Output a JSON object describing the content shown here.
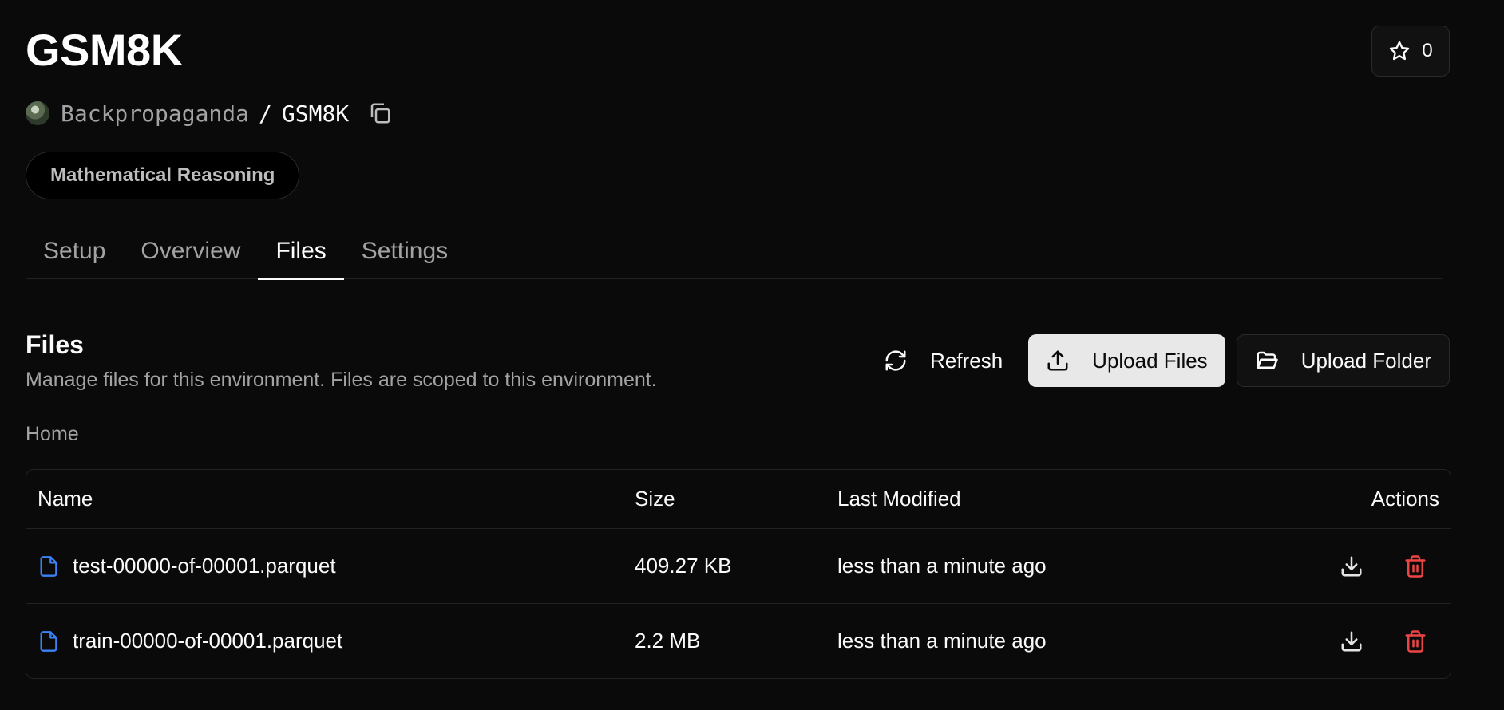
{
  "header": {
    "title": "GSM8K",
    "stars": "0",
    "owner": "Backpropaganda",
    "separator": "/",
    "repo_name": "GSM8K",
    "tag": "Mathematical Reasoning"
  },
  "tabs": [
    {
      "label": "Setup"
    },
    {
      "label": "Overview"
    },
    {
      "label": "Files",
      "active": true
    },
    {
      "label": "Settings"
    }
  ],
  "files_section": {
    "title": "Files",
    "description": "Manage files for this environment. Files are scoped to this environment.",
    "refresh_label": "Refresh",
    "upload_files_label": "Upload Files",
    "upload_folder_label": "Upload Folder",
    "breadcrumb": "Home"
  },
  "table": {
    "columns": [
      "Name",
      "Size",
      "Last Modified",
      "Actions"
    ],
    "rows": [
      {
        "name": "test-00000-of-00001.parquet",
        "size": "409.27 KB",
        "modified": "less than a minute ago"
      },
      {
        "name": "train-00000-of-00001.parquet",
        "size": "2.2 MB",
        "modified": "less than a minute ago"
      }
    ]
  },
  "icons": {
    "star": "star-icon",
    "copy": "copy-icon",
    "refresh": "refresh-icon",
    "upload": "upload-icon",
    "folder": "folder-open-icon",
    "file": "file-icon",
    "download": "download-icon",
    "delete": "trash-icon"
  },
  "colors": {
    "background": "#0a0a0a",
    "file_icon": "#3b82f6",
    "delete": "#ef4444"
  }
}
